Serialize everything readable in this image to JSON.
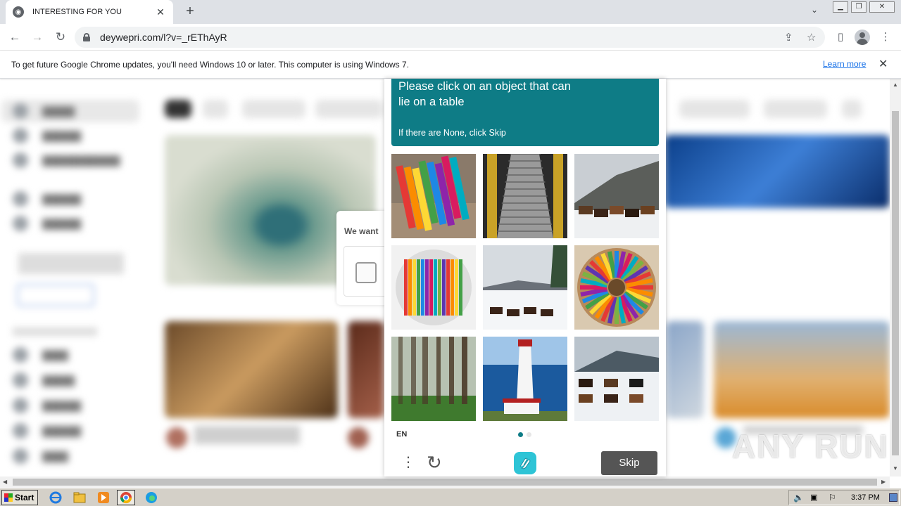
{
  "browser": {
    "tab_title": "INTERESTING FOR YOU",
    "url": "deywepri.com/l?v=_rEThAyR"
  },
  "infobar": {
    "message": "To get future Google Chrome updates, you'll need Windows 10 or later. This computer is using Windows 7.",
    "learn_more": "Learn more"
  },
  "background_dialog": {
    "text": "We want"
  },
  "captcha": {
    "title": "Please click on an object that can lie on a table",
    "subtitle": "If there are None, click Skip",
    "language": "EN",
    "skip_label": "Skip",
    "images": [
      {
        "name": "colored-pencils-cup",
        "kind": "pencils-cup"
      },
      {
        "name": "escalator",
        "kind": "escalator"
      },
      {
        "name": "cows-mountain",
        "kind": "cows"
      },
      {
        "name": "colored-pencils-round",
        "kind": "pencils-round"
      },
      {
        "name": "cows-snow-tree",
        "kind": "cows-snow"
      },
      {
        "name": "colored-pencils-wheel",
        "kind": "pencils-wheel"
      },
      {
        "name": "foggy-forest",
        "kind": "forest"
      },
      {
        "name": "lighthouse",
        "kind": "lighthouse"
      },
      {
        "name": "cows-snow-field",
        "kind": "cows-field"
      }
    ],
    "colors": {
      "prompt_bg": "#0e7c86",
      "skip_bg": "#555555",
      "dot_active": "#0e7c86"
    }
  },
  "watermark": "ANY RUN",
  "taskbar": {
    "start_label": "Start",
    "clock": "3:37 PM"
  }
}
